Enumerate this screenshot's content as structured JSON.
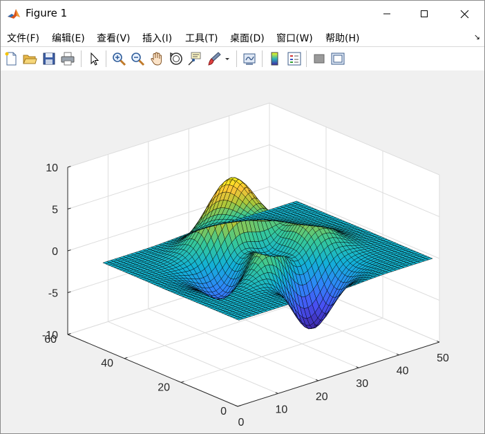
{
  "window": {
    "title": "Figure 1",
    "app_icon": "matlab-logo-icon",
    "controls": [
      "minimize-icon",
      "maximize-icon",
      "close-icon"
    ]
  },
  "menu": {
    "items": [
      {
        "label": "文件(F)"
      },
      {
        "label": "编辑(E)"
      },
      {
        "label": "查看(V)"
      },
      {
        "label": "插入(I)"
      },
      {
        "label": "工具(T)"
      },
      {
        "label": "桌面(D)"
      },
      {
        "label": "窗口(W)"
      },
      {
        "label": "帮助(H)"
      }
    ],
    "corner_glyph": "↘"
  },
  "toolbar": {
    "buttons": [
      "new-figure-icon",
      "open-file-icon",
      "save-icon",
      "print-icon",
      "edit-plot-arrow-icon",
      "zoom-in-icon",
      "zoom-out-icon",
      "pan-hand-icon",
      "rotate-3d-icon",
      "data-cursor-icon",
      "brush-icon",
      "brush-dropdown-icon",
      "link-plot-icon",
      "colorbar-icon",
      "legend-icon",
      "hide-plot-tools-icon",
      "show-plot-tools-icon"
    ]
  },
  "chart_data": {
    "type": "surface",
    "function": "peaks",
    "grid_size": 49,
    "colormap": "parula",
    "edge_color": "#000000",
    "title": "",
    "xlabel": "",
    "ylabel": "",
    "zlabel": "",
    "xlim": [
      0,
      50
    ],
    "ylim": [
      0,
      60
    ],
    "zlim": [
      -10,
      10
    ],
    "x_ticks": [
      0,
      10,
      20,
      30,
      40,
      50
    ],
    "y_ticks": [
      0,
      20,
      40,
      60
    ],
    "z_ticks": [
      -10,
      -5,
      0,
      5,
      10
    ],
    "x_tick_labels": [
      "0",
      "10",
      "20",
      "30",
      "40",
      "50"
    ],
    "y_tick_labels": [
      "0",
      "20",
      "40",
      "60"
    ],
    "z_tick_labels": [
      "-10",
      "-5",
      "0",
      "5",
      "10"
    ],
    "grid": true,
    "view": "3-D default (azimuth -37.5, elevation 30)"
  }
}
